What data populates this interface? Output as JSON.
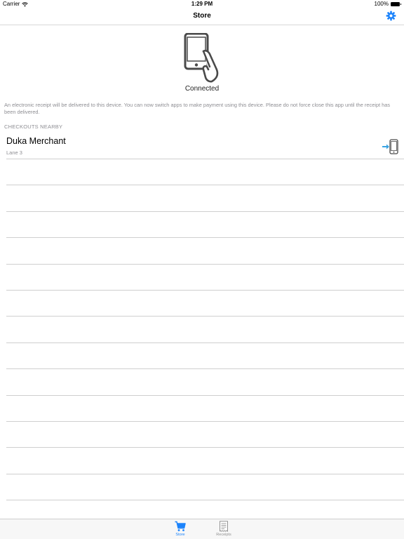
{
  "status_bar": {
    "carrier": "Carrier",
    "time": "1:29 PM",
    "battery": "100%"
  },
  "nav": {
    "title": "Store",
    "settings_icon": "gear-icon"
  },
  "connection": {
    "status": "Connected",
    "icon": "phone-tap-icon",
    "message": "An electronic receipt will be delivered to this device. You can now switch apps to make payment using this device. Please do not force close this app until the receipt has been delivered."
  },
  "checkouts": {
    "header": "CHECKOUTS NEARBY",
    "items": [
      {
        "name": "Duka Merchant",
        "lane": "Lane 3",
        "icon": "connect-to-device-icon"
      }
    ]
  },
  "tab_bar": {
    "tabs": [
      {
        "label": "Store",
        "icon": "cart-icon",
        "active": true
      },
      {
        "label": "Receipts",
        "icon": "receipt-icon",
        "active": false
      }
    ]
  },
  "colors": {
    "accent": "#1a82fb",
    "secondary_text": "#8e8e93",
    "icon_gray": "#4a4a4a",
    "arrow_blue": "#3aa3e3"
  }
}
